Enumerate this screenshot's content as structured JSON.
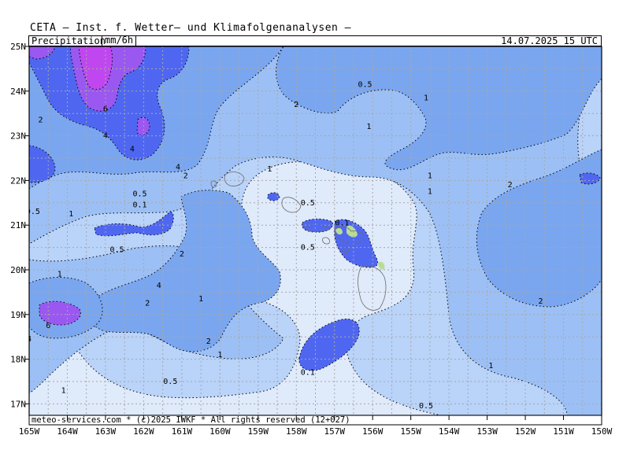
{
  "header": {
    "title": "CETA  —  Inst. f. Wetter— und Klimafolgenanalysen  —",
    "parameter": "Precipitation",
    "unit": "mm/6h",
    "valid_time": "14.07.2025 15 UTC"
  },
  "footer": {
    "copyright": "meteo-services.com * (c)2025 IWKF * All rights reserved (12+027)"
  },
  "axes": {
    "lon_labels": [
      "165W",
      "164W",
      "163W",
      "162W",
      "161W",
      "160W",
      "159W",
      "158W",
      "157W",
      "156W",
      "155W",
      "154W",
      "153W",
      "152W",
      "151W",
      "150W"
    ],
    "lat_labels": [
      "25N",
      "24N",
      "23N",
      "22N",
      "21N",
      "20N",
      "19N",
      "18N",
      "17N"
    ]
  },
  "contour_labels": [
    {
      "text": "0.5",
      "lon": -156.2,
      "lat": 24.15
    },
    {
      "text": "1",
      "lon": -154.6,
      "lat": 23.85
    },
    {
      "text": "2",
      "lon": -158.0,
      "lat": 23.7
    },
    {
      "text": "1",
      "lon": -156.1,
      "lat": 23.2
    },
    {
      "text": "6",
      "lon": -163.0,
      "lat": 23.6
    },
    {
      "text": "2",
      "lon": -164.7,
      "lat": 23.35
    },
    {
      "text": "4",
      "lon": -163.0,
      "lat": 23.0
    },
    {
      "text": "4",
      "lon": -162.3,
      "lat": 22.7
    },
    {
      "text": "4",
      "lon": -161.1,
      "lat": 22.3
    },
    {
      "text": "2",
      "lon": -160.9,
      "lat": 22.1
    },
    {
      "text": "1",
      "lon": -158.7,
      "lat": 22.25
    },
    {
      "text": "1",
      "lon": -154.5,
      "lat": 22.1
    },
    {
      "text": "1",
      "lon": -154.5,
      "lat": 21.75
    },
    {
      "text": "2",
      "lon": -152.4,
      "lat": 21.9
    },
    {
      "text": "0.5",
      "lon": -162.1,
      "lat": 21.7
    },
    {
      "text": "0.1",
      "lon": -162.1,
      "lat": 21.45
    },
    {
      "text": "0.5",
      "lon": -157.7,
      "lat": 21.5
    },
    {
      "text": "0.5",
      "lon": -164.9,
      "lat": 21.3
    },
    {
      "text": "1",
      "lon": -163.9,
      "lat": 21.25
    },
    {
      "text": "0.1",
      "lon": -156.8,
      "lat": 21.05
    },
    {
      "text": "0.5",
      "lon": -157.7,
      "lat": 20.5
    },
    {
      "text": "0.5",
      "lon": -162.7,
      "lat": 20.45
    },
    {
      "text": "2",
      "lon": -161.0,
      "lat": 20.35
    },
    {
      "text": "1",
      "lon": -164.2,
      "lat": 19.9
    },
    {
      "text": "4",
      "lon": -161.6,
      "lat": 19.65
    },
    {
      "text": "2",
      "lon": -161.9,
      "lat": 19.25
    },
    {
      "text": "1",
      "lon": -160.5,
      "lat": 19.35
    },
    {
      "text": "2",
      "lon": -151.6,
      "lat": 19.3
    },
    {
      "text": "6",
      "lon": -164.5,
      "lat": 18.75
    },
    {
      "text": "4",
      "lon": -165.0,
      "lat": 18.45
    },
    {
      "text": "2",
      "lon": -160.3,
      "lat": 18.4
    },
    {
      "text": "1",
      "lon": -160.0,
      "lat": 18.1
    },
    {
      "text": "0.1",
      "lon": -157.7,
      "lat": 17.7
    },
    {
      "text": "1",
      "lon": -152.9,
      "lat": 17.85
    },
    {
      "text": "0.5",
      "lon": -161.3,
      "lat": 17.5
    },
    {
      "text": "1",
      "lon": -164.1,
      "lat": 17.3
    },
    {
      "text": "0.5",
      "lon": -154.6,
      "lat": 16.95
    }
  ],
  "colors": {
    "ocean_background": "#dfeafb",
    "level_0_1": "#dbe7fb",
    "level_0_5": "#b9d3f9",
    "level_1": "#9cc0f5",
    "level_2": "#7aa6ef",
    "level_4": "#4f67f0",
    "level_6": "#9a58f0",
    "level_8": "#c047ef",
    "level_high": "#b8dd97",
    "grid": "#a7a7a7"
  }
}
